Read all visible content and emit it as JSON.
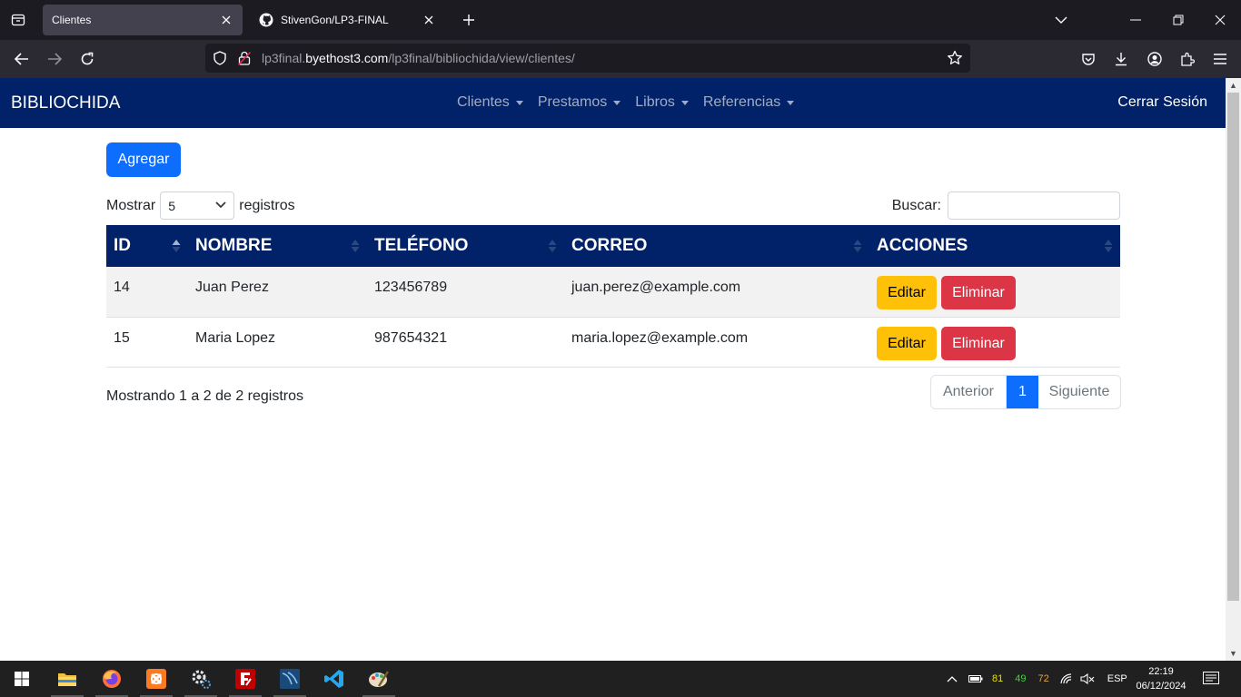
{
  "browser": {
    "tabs": [
      {
        "label": "Clientes",
        "active": true
      },
      {
        "label": "StivenGon/LP3-FINAL",
        "active": false
      }
    ],
    "url_prefix": "lp3final.",
    "url_domain": "byethost3.com",
    "url_path": "/lp3final/bibliochida/view/clientes/"
  },
  "site": {
    "brand": "BIBLIOCHIDA",
    "menu": [
      "Clientes",
      "Prestamos",
      "Libros",
      "Referencias"
    ],
    "logout": "Cerrar Sesión",
    "colors": {
      "navbar": "#012268",
      "primary": "#0d6efd",
      "warning": "#ffc107",
      "danger": "#dc3545"
    }
  },
  "toolbar": {
    "add_label": "Agregar",
    "length_prefix": "Mostrar",
    "length_value": "5",
    "length_suffix": "registros",
    "search_label": "Buscar:",
    "search_value": ""
  },
  "table": {
    "columns": [
      "ID",
      "NOMBRE",
      "TELÉFONO",
      "CORREO",
      "ACCIONES"
    ],
    "rows": [
      {
        "id": "14",
        "nombre": "Juan Perez",
        "telefono": "123456789",
        "correo": "juan.perez@example.com"
      },
      {
        "id": "15",
        "nombre": "Maria Lopez",
        "telefono": "987654321",
        "correo": "maria.lopez@example.com"
      }
    ],
    "edit_label": "Editar",
    "delete_label": "Eliminar"
  },
  "footer": {
    "info": "Mostrando 1 a 2 de 2 registros",
    "prev": "Anterior",
    "current_page": "1",
    "next": "Siguiente"
  },
  "taskbar": {
    "apps": [
      "windows-start",
      "file-explorer",
      "firefox",
      "xampp",
      "settings-gear",
      "filezilla",
      "mysql-workbench",
      "vscode",
      "paint"
    ],
    "tray_values": [
      "81",
      "49",
      "72"
    ],
    "language": "ESP",
    "time": "22:19",
    "date": "06/12/2024"
  }
}
